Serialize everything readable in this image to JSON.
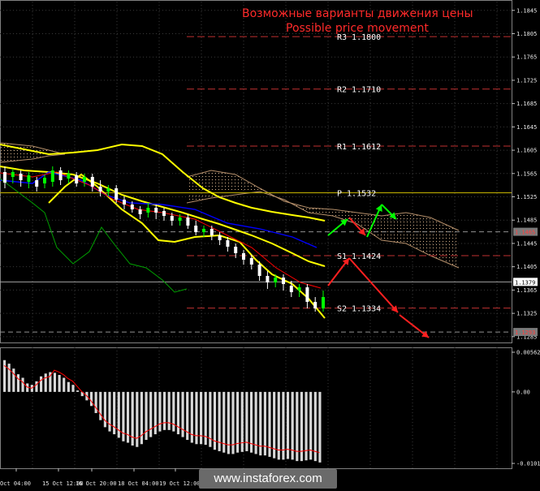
{
  "header": {
    "title_ru": "Возможные варианты движения цены",
    "title_en": "Possible price movement"
  },
  "watermark": "www.instaforex.com",
  "chart_data": {
    "type": "line",
    "xlabels": [
      "Oct 04:00",
      "15 Oct 12:00",
      "16 Oct 20:00",
      "18 Oct 04:00",
      "19 Oct 12:00"
    ],
    "price_axis": {
      "ticks": [
        "1.1845",
        "1.1805",
        "1.1765",
        "1.1725",
        "1.1685",
        "1.1645",
        "1.1605",
        "1.1565",
        "1.1525",
        "1.1485",
        "1.1445",
        "1.1405",
        "1.1365",
        "1.1325",
        "1.1285"
      ],
      "current": "1.1379",
      "marker1": "1.1465",
      "marker2": "1.1293",
      "ylim": [
        1.1275,
        1.186
      ]
    },
    "levels": [
      {
        "name": "R3",
        "value": "1.1800",
        "label": "R3 1.1800"
      },
      {
        "name": "R2",
        "value": "1.1710",
        "label": "R2 1.1710"
      },
      {
        "name": "R1",
        "value": "1.1612",
        "label": "R1 1.1612"
      },
      {
        "name": "P",
        "value": "1.1532",
        "label": "P 1.1532"
      },
      {
        "name": "S1",
        "value": "1.1424",
        "label": "S1 1.1424"
      },
      {
        "name": "S2",
        "value": "1.1334",
        "label": "S2 1.1334"
      }
    ],
    "macd_axis": {
      "ticks": [
        "0.00562",
        "0.00",
        "-0.01013"
      ]
    },
    "colors": {
      "bull_candle": "#00ff00",
      "bear_candle": "#ffffff",
      "bollinger": "#ffff00",
      "tenkan": "#ff0000",
      "kijun": "#0000ff",
      "chikou": "#00a000",
      "pivot_line": "#b0a000",
      "level_line": "#c03030",
      "arrow_up": "#00ff00",
      "arrow_down": "#ff2020"
    }
  }
}
